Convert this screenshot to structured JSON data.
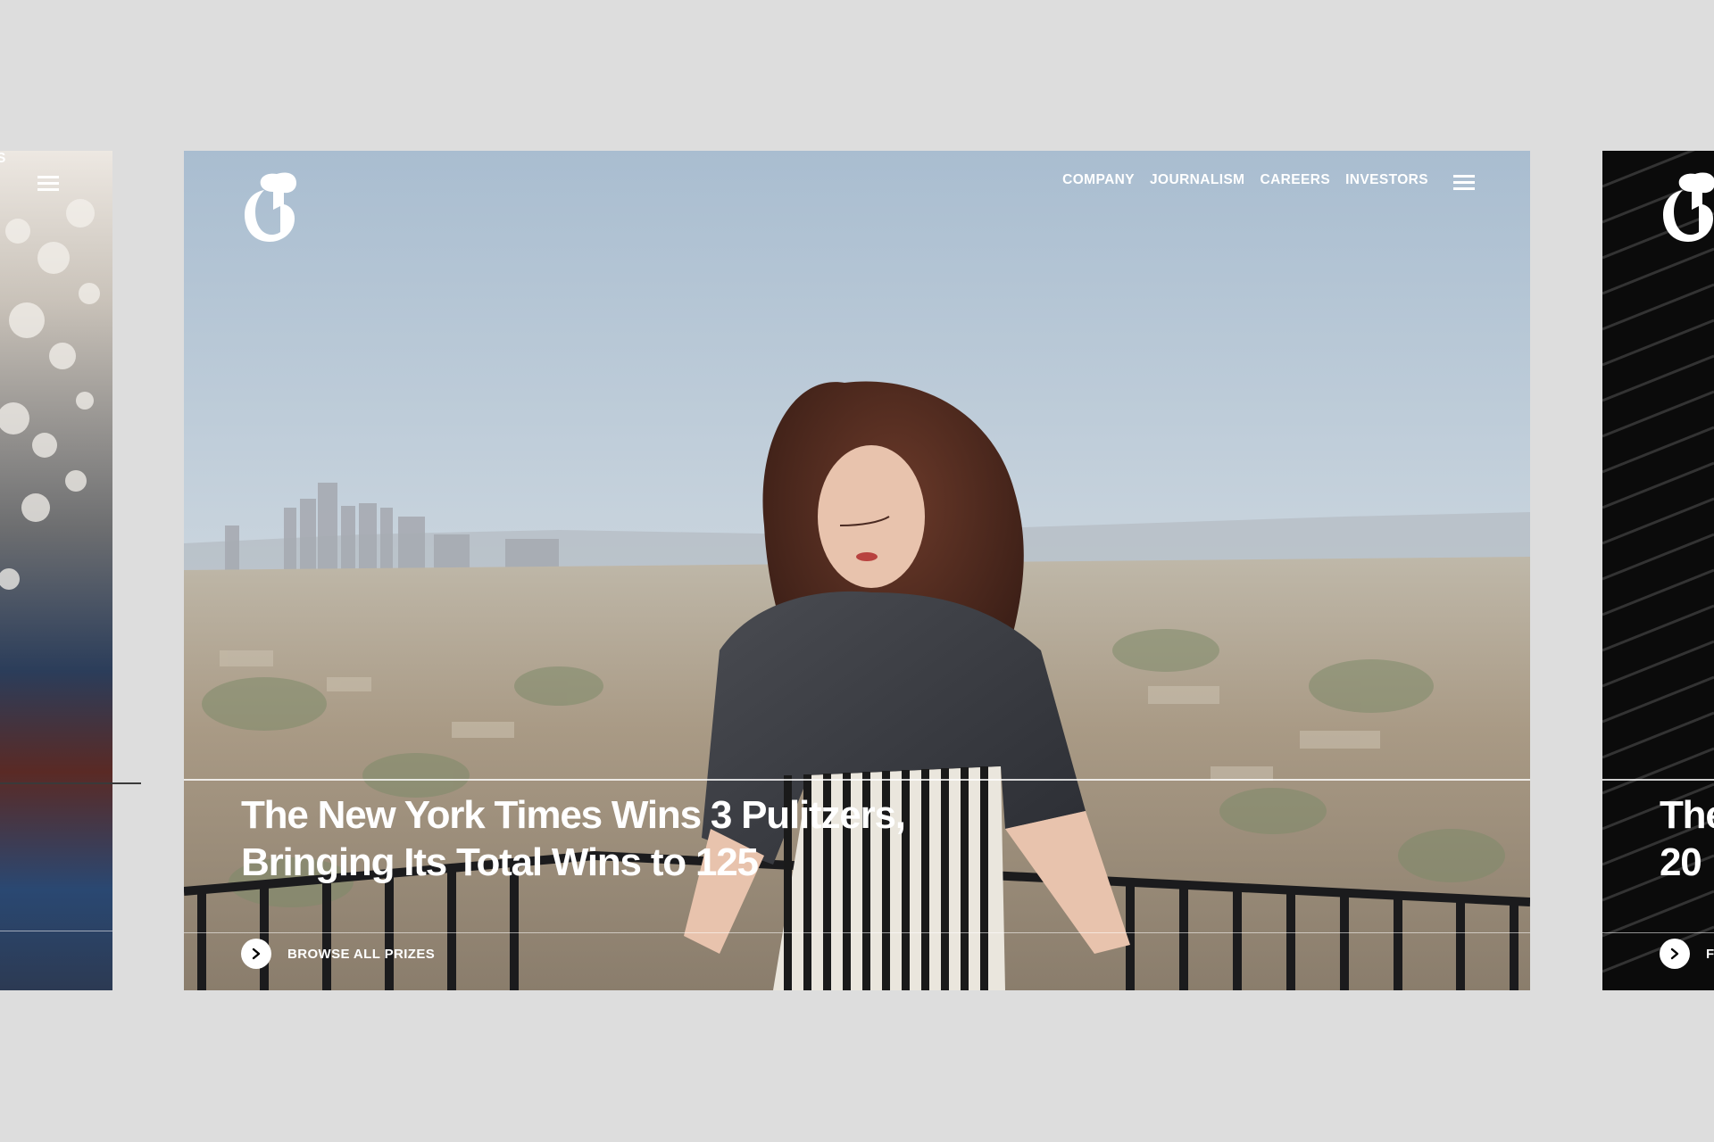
{
  "prev_slide": {
    "nav_tail": "S"
  },
  "main_slide": {
    "brand": "The New York Times",
    "nav": {
      "items": [
        {
          "label": "COMPANY"
        },
        {
          "label": "JOURNALISM"
        },
        {
          "label": "CAREERS"
        },
        {
          "label": "INVESTORS"
        }
      ]
    },
    "headline": "The New York Times Wins 3 Pulitzers, Bringing Its Total Wins to 125",
    "cta_label": "BROWSE ALL PRIZES",
    "icons": {
      "logo": "nyt-t-logo-icon",
      "menu": "hamburger-menu-icon",
      "cta": "arrow-right-circle-icon"
    }
  },
  "next_slide": {
    "headline_line1": "The",
    "headline_line2": "20",
    "cta_fragment": "F"
  },
  "colors": {
    "page_background": "#dddddd",
    "text_on_image": "#ffffff",
    "next_slide_background": "#0b0b0b"
  }
}
